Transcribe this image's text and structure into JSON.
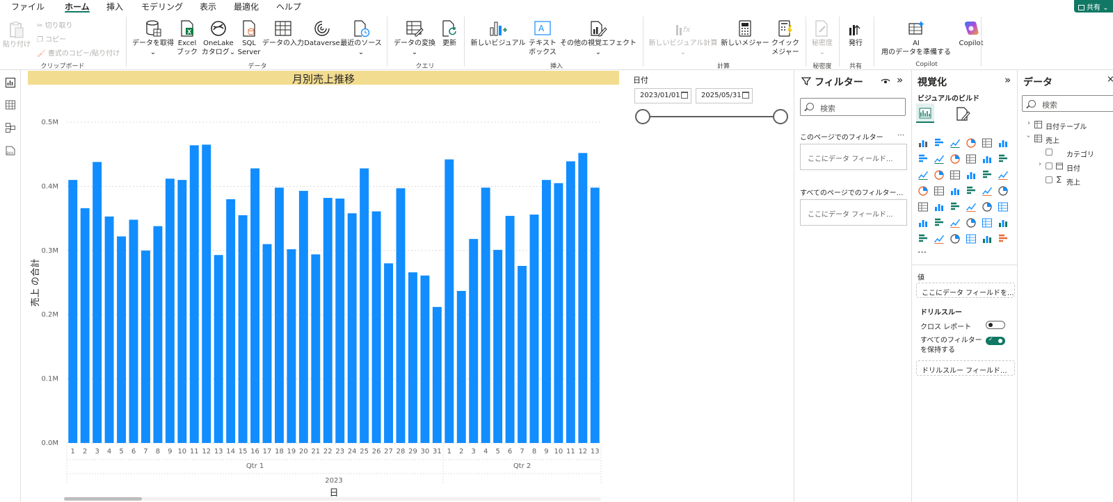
{
  "menu": {
    "tabs": [
      {
        "label": "ファイル"
      },
      {
        "label": "ホーム"
      },
      {
        "label": "挿入"
      },
      {
        "label": "モデリング"
      },
      {
        "label": "表示"
      },
      {
        "label": "最適化"
      },
      {
        "label": "ヘルプ"
      }
    ],
    "active_tab": "ホーム",
    "share_label": "共有"
  },
  "ribbon": {
    "clipboard": {
      "paste": "貼り付け",
      "cut": "切り取り",
      "copy": "コピー",
      "format_painter": "書式のコピー/貼り付け",
      "group": "クリップボード"
    },
    "data": {
      "get_data_1": "データを取得",
      "excel_1": "Excel",
      "excel_2": "ブック",
      "onelake_1": "OneLake",
      "onelake_2": "カタログ",
      "sql_1": "SQL",
      "sql_2": "Server",
      "enter_data": "データの入力",
      "dataverse": "Dataverse",
      "recent_sources": "最近のソース",
      "group": "データ"
    },
    "query": {
      "transform": "データの変換",
      "refresh": "更新",
      "group": "クエリ"
    },
    "insert": {
      "new_visual": "新しいビジュアル",
      "textbox_1": "テキスト",
      "textbox_2": "ボックス",
      "more_visuals": "その他の視覚エフェクト",
      "group": "挿入"
    },
    "calc": {
      "new_visual_calc": "新しいビジュアル計算",
      "new_measure": "新しいメジャー",
      "quick_measure_1": "クイック",
      "quick_measure_2": "メジャー",
      "group": "計算"
    },
    "sensitivity": {
      "label": "秘密度",
      "group": "秘密度"
    },
    "share": {
      "publish": "発行",
      "group": "共有"
    },
    "copilot": {
      "ai_1": "AI",
      "ai_2": "用のデータを準備する",
      "copilot": "Copilot",
      "group": "Copilot"
    }
  },
  "report": {
    "title": "月別売上推移",
    "slicer_label": "日付",
    "start_date": "2023/01/01",
    "end_date": "2025/05/31"
  },
  "chart_data": {
    "type": "bar",
    "title": "月別売上推移",
    "xlabel": "日",
    "ylabel": "売上 の合計",
    "ylim": [
      0,
      0.5
    ],
    "yunit": "M",
    "yticks": [
      "0.0M",
      "0.1M",
      "0.2M",
      "0.3M",
      "0.4M",
      "0.5M"
    ],
    "categories": [
      "1",
      "2",
      "3",
      "4",
      "5",
      "6",
      "7",
      "8",
      "9",
      "10",
      "11",
      "12",
      "13",
      "14",
      "15",
      "16",
      "17",
      "18",
      "19",
      "20",
      "21",
      "22",
      "23",
      "24",
      "25",
      "26",
      "27",
      "28",
      "29",
      "30",
      "31",
      "1",
      "2",
      "3",
      "4",
      "5",
      "6",
      "7",
      "8",
      "9",
      "10",
      "11",
      "12",
      "13"
    ],
    "values": [
      0.41,
      0.366,
      0.438,
      0.353,
      0.322,
      0.348,
      0.3,
      0.338,
      0.412,
      0.41,
      0.464,
      0.465,
      0.293,
      0.38,
      0.355,
      0.428,
      0.31,
      0.398,
      0.302,
      0.393,
      0.294,
      0.382,
      0.381,
      0.358,
      0.428,
      0.361,
      0.28,
      0.397,
      0.266,
      0.261,
      0.212,
      0.442,
      0.237,
      0.318,
      0.398,
      0.301,
      0.354,
      0.276,
      0.356,
      0.41,
      0.405,
      0.439,
      0.452,
      0.398
    ],
    "groups": [
      {
        "label": "Qtr 1",
        "count": 31
      },
      {
        "label": "Qtr 2",
        "count": 13
      }
    ],
    "year": "2023",
    "bar_color": "#118DFF",
    "grid": true,
    "legend": "none"
  },
  "filters": {
    "title": "フィルター",
    "search_placeholder": "検索",
    "this_page": "このページでのフィルター",
    "all_pages": "すべてのページでのフィルター…",
    "more": "…",
    "drop_here": "ここにデータ フィールド..."
  },
  "viz": {
    "title": "視覚化",
    "build": "ビジュアルのビルド",
    "more": "…",
    "values_label": "値",
    "values_well": "ここにデータ フィールドを...",
    "drillthrough": "ドリルスルー",
    "cross_report": "クロス レポート",
    "keep_filters_1": "すべてのフィルター",
    "keep_filters_2": "を保持する",
    "drill_well": "ドリルスルー フィールド...",
    "cross_report_state": "off",
    "keep_filters_state": "on"
  },
  "data_pane": {
    "title": "データ",
    "search_placeholder": "検索",
    "tables": [
      {
        "name": "日付テーブル"
      },
      {
        "name": "売上",
        "fields": [
          {
            "name": "カテゴリ"
          },
          {
            "name": "日付"
          },
          {
            "name": "売上"
          }
        ]
      }
    ]
  },
  "colors": {
    "accent": "#117865",
    "bar": "#118DFF",
    "title_bar": "#F2DC8F"
  }
}
